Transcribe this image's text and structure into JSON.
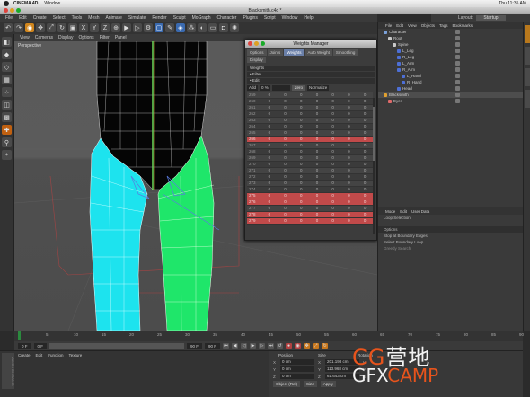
{
  "macbar": {
    "app": "CINEMA 4D",
    "menu": "Window",
    "clock": "Thu 11:35 AM"
  },
  "window": {
    "title": "Blacksmith.c4d *"
  },
  "main_menu": [
    "File",
    "Edit",
    "Create",
    "Select",
    "Tools",
    "Mesh",
    "Animate",
    "Simulate",
    "Render",
    "Sculpt",
    "MoGraph",
    "Character",
    "Plugins",
    "Script",
    "Window",
    "Help"
  ],
  "layout": {
    "label": "Layout:",
    "value": "Startup"
  },
  "viewport": {
    "menu": [
      "View",
      "Cameras",
      "Display",
      "Options",
      "Filter",
      "Panel"
    ],
    "label": "Perspective"
  },
  "weights_manager": {
    "title": "Weights Manager",
    "tabs": [
      "Options",
      "Joints",
      "Weights",
      "Auto Weight",
      "Smoothing",
      "Display"
    ],
    "active_tab": "Weights",
    "section_weights": "Weights",
    "filter_label": "• Filter",
    "edit_label": "• Edit",
    "mode": "Add",
    "strength": "0 %",
    "zero_button": "Zero",
    "normalize": "Normalize",
    "rows": [
      {
        "idx": "259",
        "vals": [
          "0",
          "0",
          "0",
          "0",
          "0",
          "0",
          "0"
        ],
        "hl": false
      },
      {
        "idx": "260",
        "vals": [
          "0",
          "0",
          "0",
          "0",
          "0",
          "0",
          "0"
        ],
        "hl": false
      },
      {
        "idx": "261",
        "vals": [
          "0",
          "0",
          "0",
          "0",
          "0",
          "0",
          "0"
        ],
        "hl": false
      },
      {
        "idx": "262",
        "vals": [
          "0",
          "0",
          "0",
          "0",
          "0",
          "0",
          "0"
        ],
        "hl": false
      },
      {
        "idx": "263",
        "vals": [
          "0",
          "0",
          "0",
          "0",
          "0",
          "0",
          "0"
        ],
        "hl": false
      },
      {
        "idx": "264",
        "vals": [
          "0",
          "0",
          "0",
          "0",
          "0",
          "0",
          "0"
        ],
        "hl": false
      },
      {
        "idx": "265",
        "vals": [
          "0",
          "0",
          "0",
          "0",
          "0",
          "0",
          "0"
        ],
        "hl": false
      },
      {
        "idx": "266",
        "vals": [
          "0",
          "0",
          "0",
          "0",
          "0",
          "0",
          "0"
        ],
        "hl": true
      },
      {
        "idx": "267",
        "vals": [
          "0",
          "0",
          "0",
          "0",
          "0",
          "0",
          "0"
        ],
        "hl": false
      },
      {
        "idx": "268",
        "vals": [
          "0",
          "0",
          "0",
          "0",
          "0",
          "0",
          "0"
        ],
        "hl": false
      },
      {
        "idx": "269",
        "vals": [
          "0",
          "0",
          "0",
          "0",
          "0",
          "0",
          "0"
        ],
        "hl": false
      },
      {
        "idx": "270",
        "vals": [
          "0",
          "0",
          "0",
          "0",
          "0",
          "0",
          "0"
        ],
        "hl": false
      },
      {
        "idx": "271",
        "vals": [
          "0",
          "0",
          "0",
          "0",
          "0",
          "0",
          "0"
        ],
        "hl": false
      },
      {
        "idx": "272",
        "vals": [
          "0",
          "0",
          "0",
          "0",
          "0",
          "0",
          "0"
        ],
        "hl": false
      },
      {
        "idx": "273",
        "vals": [
          "0",
          "0",
          "0",
          "0",
          "0",
          "0",
          "0"
        ],
        "hl": false
      },
      {
        "idx": "274",
        "vals": [
          "0",
          "0",
          "0",
          "0",
          "0",
          "0",
          "0"
        ],
        "hl": false
      },
      {
        "idx": "275",
        "vals": [
          "0",
          "0",
          "0",
          "0",
          "0",
          "0",
          "0"
        ],
        "hl": true
      },
      {
        "idx": "276",
        "vals": [
          "0",
          "0",
          "0",
          "0",
          "0",
          "0",
          "0"
        ],
        "hl": true
      },
      {
        "idx": "277",
        "vals": [
          "0",
          "0",
          "0",
          "0",
          "0",
          "0",
          "0"
        ],
        "hl": false
      },
      {
        "idx": "278",
        "vals": [
          "0",
          "0",
          "0",
          "0",
          "0",
          "0",
          "0"
        ],
        "hl": true
      },
      {
        "idx": "279",
        "vals": [
          "0",
          "0",
          "0",
          "0",
          "0",
          "0",
          "0"
        ],
        "hl": true
      }
    ]
  },
  "object_manager": {
    "menu": [
      "File",
      "Edit",
      "View",
      "Objects",
      "Tags",
      "Bookmarks"
    ],
    "items": [
      {
        "name": "Character",
        "indent": 0,
        "color": "#7aa0d8"
      },
      {
        "name": "Root",
        "indent": 1,
        "color": "#c8c8c8"
      },
      {
        "name": "Spine",
        "indent": 2,
        "color": "#c8c8c8"
      },
      {
        "name": "L_Leg",
        "indent": 3,
        "color": "#4d6fd6"
      },
      {
        "name": "R_Leg",
        "indent": 3,
        "color": "#4d6fd6"
      },
      {
        "name": "L_Arm",
        "indent": 3,
        "color": "#4d6fd6"
      },
      {
        "name": "R_Arm",
        "indent": 3,
        "color": "#4d6fd6"
      },
      {
        "name": "L_Hand",
        "indent": 4,
        "color": "#4d6fd6"
      },
      {
        "name": "R_Hand",
        "indent": 4,
        "color": "#4d6fd6"
      },
      {
        "name": "Head",
        "indent": 3,
        "color": "#4d6fd6"
      },
      {
        "name": "Blacksmith",
        "indent": 0,
        "color": "#e0a030"
      },
      {
        "name": "Eyes",
        "indent": 1,
        "color": "#e06a6a"
      }
    ]
  },
  "attribute_manager": {
    "menu": [
      "Mode",
      "Edit",
      "User Data"
    ],
    "loop_selection": "Loop Selection",
    "section": "Options",
    "option1": "Stop at Boundary Edges",
    "option2": "Select Boundary Loop",
    "option3": "Greedy Search"
  },
  "timeline": {
    "ticks": [
      "0",
      "5",
      "10",
      "15",
      "20",
      "25",
      "30",
      "35",
      "40",
      "45",
      "50",
      "55",
      "60",
      "65",
      "70",
      "75",
      "80",
      "85",
      "90"
    ],
    "current_frame": "0 F",
    "start": "0 F",
    "end": "90 F",
    "end2": "90 F"
  },
  "materials": {
    "menu": [
      "Create",
      "Edit",
      "Function",
      "Texture"
    ],
    "logo": "MAXON CINEMA 4D"
  },
  "coordinates": {
    "headers": [
      "Position",
      "Size",
      "Rotation"
    ],
    "rows": [
      {
        "axis": "X",
        "pos": "0 cm",
        "size": "201.198 cm",
        "rot": "H"
      },
      {
        "axis": "Y",
        "pos": "0 cm",
        "size": "113.968 cm",
        "rot": "P"
      },
      {
        "axis": "Z",
        "pos": "0 cm",
        "size": "61.643 cm",
        "rot": "B"
      }
    ],
    "mode": "Object (Rel)",
    "size_mode": "Size",
    "apply": "Apply"
  },
  "watermark": {
    "line1": "CG营地",
    "line2": "GFXCAMP"
  }
}
